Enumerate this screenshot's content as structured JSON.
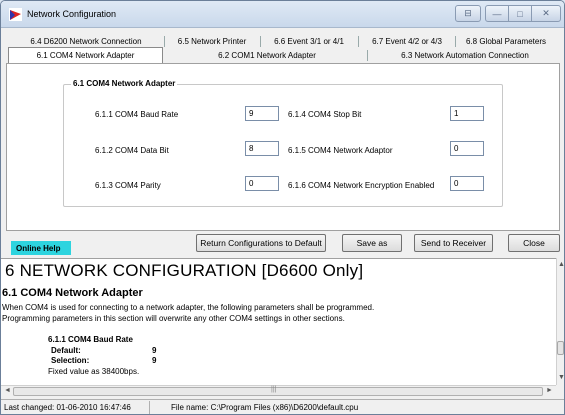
{
  "window": {
    "title": "Network Configuration",
    "buttons": {
      "menu": "⊟",
      "minimize": "—",
      "maximize": "□",
      "close": "✕"
    }
  },
  "tabs": {
    "row1": [
      "6.4 D6200 Network Connection",
      "6.5 Network Printer",
      "6.6 Event 3/1 or 4/1",
      "6.7 Event 4/2 or 4/3",
      "6.8 Global Parameters"
    ],
    "row2": [
      "6.1 COM4 Network Adapter",
      "6.2 COM1 Network Adapter",
      "6.3  Network Automation Connection"
    ],
    "active": "6.1 COM4 Network Adapter"
  },
  "group": {
    "title": "6.1 COM4 Network Adapter",
    "fields": [
      {
        "label": "6.1.1 COM4 Baud Rate",
        "value": "9"
      },
      {
        "label": "6.1.2 COM4 Data Bit",
        "value": "8"
      },
      {
        "label": "6.1.3 COM4 Parity",
        "value": "0"
      },
      {
        "label": "6.1.4 COM4 Stop Bit",
        "value": "1"
      },
      {
        "label": "6.1.5 COM4 Network Adaptor",
        "value": "0"
      },
      {
        "label": "6.1.6 COM4 Network Encryption Enabled",
        "value": "0"
      }
    ]
  },
  "buttons": {
    "online_help": "Online Help",
    "return_defaults": "Return Configurations to Default",
    "save_as": "Save as",
    "send_to_receiver": "Send to Receiver",
    "close": "Close"
  },
  "help": {
    "heading": "6   NETWORK CONFIGURATION [D6600 Only]",
    "subheading": "6.1 COM4 Network Adapter",
    "para1": "When COM4 is used for connecting to a network adapter, the following parameters shall be programmed.",
    "para2": "Programming parameters in this section will overwrite any other COM4 settings in other sections.",
    "item_title": "6.1.1 COM4 Baud Rate",
    "default_label": "Default:",
    "default_value": "9",
    "selection_label": "Selection:",
    "selection_value": "9",
    "note": "Fixed value as 38400bps."
  },
  "scroll": {
    "up": "▲",
    "down": "▼",
    "left": "◄",
    "right": "►",
    "grip": "|||"
  },
  "status": {
    "last_changed": "Last changed: 01-06-2010 16:47:46",
    "file_name": "File name: C:\\Program Files (x86)\\D6200\\default.cpu"
  },
  "colors": {
    "help_button": "#2dd4df",
    "window_bg": "#f0f0f0",
    "titlebar": "#c9d8eb"
  }
}
